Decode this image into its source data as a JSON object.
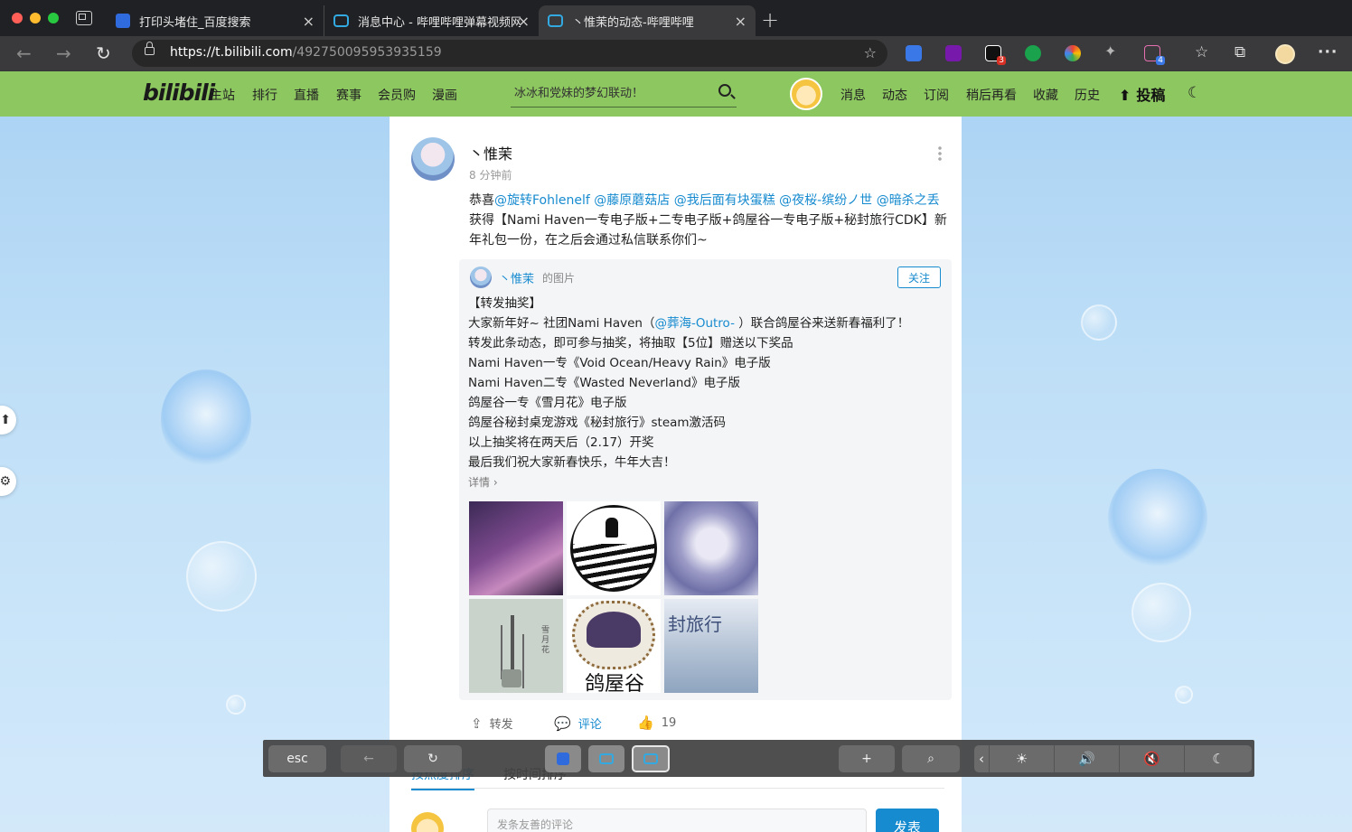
{
  "browser": {
    "tabs": [
      {
        "title": "打印头堵住_百度搜索",
        "icon": "baidu-icon"
      },
      {
        "title": "消息中心 - 哔哩哔哩弹幕视频网",
        "icon": "bilibili-icon"
      },
      {
        "title": "丶惟茉的动态-哔哩哔哩",
        "icon": "bilibili-icon",
        "active": true
      }
    ],
    "new_tab": "+",
    "close": "×",
    "url_host": "https://t.bilibili.com",
    "url_path": "/492750095953935159",
    "ext_badges": {
      "tv": "3",
      "cat": "4"
    }
  },
  "bili": {
    "logo": "bilibili",
    "nav_left": [
      "主站",
      "排行",
      "直播",
      "赛事",
      "会员购",
      "漫画"
    ],
    "search_placeholder": "冰冰和党妹的梦幻联动！",
    "nav_right": [
      "消息",
      "动态",
      "订阅",
      "稍后再看",
      "收藏",
      "历史"
    ],
    "upload": "投稿",
    "colors": {
      "nav": "#8dc760",
      "accent": "#178bcf"
    }
  },
  "post": {
    "author": "丶惟茉",
    "time": "8 分钟前",
    "text_prefix": "恭喜",
    "mentions": [
      "@旋转Fohlenelf",
      "@藤原蘑菇店",
      "@我后面有块蛋糕",
      "@夜桜-缤纷ノ世",
      "@暗杀之丢"
    ],
    "text_suffix": " 获得【Nami Haven一专电子版+二专电子版+鸽屋谷一专电子版+秘封旅行CDK】新年礼包一份，在之后会通过私信联系你们~",
    "repost": {
      "author": "丶惟茉",
      "type": "的图片",
      "follow": "关注",
      "line1": "【转发抽奖】",
      "line2_a": "大家新年好~ 社团Nami Haven（",
      "line2_mention": "@葬海-Outro-",
      "line2_b": " ）联合鸽屋谷来送新春福利了！",
      "line3": "转发此条动态，即可参与抽奖，将抽取【5位】赠送以下奖品",
      "line4": "Nami Haven一专《Void Ocean/Heavy Rain》电子版",
      "line5": "Nami Haven二专《Wasted Neverland》电子版",
      "line6": "鸽屋谷一专《雪月花》电子版",
      "line7": "鸽屋谷秘封桌宠游戏《秘封旅行》steam激活码",
      "line8": "以上抽奖将在两天后（2.17）开奖",
      "line9": "最后我们祝大家新春快乐，牛年大吉！",
      "detail": "详情 ›",
      "thumb_texts": {
        "t4": "雪月花",
        "t5": "鸽屋谷",
        "t6": "封旅行"
      }
    },
    "actions": {
      "repost": "转发",
      "comment": "评论",
      "like_count": "19"
    },
    "sort": {
      "hot": "按热度排序",
      "time": "按时间排序"
    },
    "comment_placeholder": "发条友善的评论",
    "send": "发表"
  },
  "touchbar": {
    "esc": "esc",
    "back": "←",
    "reload": "↻",
    "new_tab": "+",
    "search": "⌕",
    "collapse": "‹",
    "brightness": "☀",
    "volume": "🔊",
    "mute": "🔇",
    "dark": "☾"
  }
}
